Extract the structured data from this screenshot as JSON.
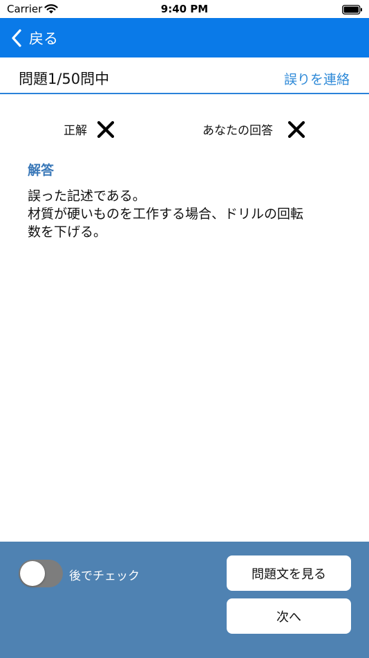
{
  "status_bar": {
    "carrier": "Carrier",
    "time": "9:40 PM"
  },
  "nav": {
    "back_label": "戻る",
    "color": "#0a7ae8"
  },
  "question": {
    "count_label": "問題1/50問中",
    "report_label": "誤りを連絡"
  },
  "result": {
    "correct_label": "正解",
    "your_answer_label": "あなたの回答",
    "correct_mark_icon": "cross-icon",
    "your_mark_icon": "cross-icon"
  },
  "answer": {
    "heading": "解答",
    "lines": [
      "誤った記述である。",
      "材質が硬いものを工作する場合、ドリルの回転",
      "数を下げる。"
    ]
  },
  "bottom": {
    "toggle_label": "後でチェック",
    "toggle_on": false,
    "view_question_label": "問題文を見る",
    "next_label": "次へ",
    "panel_color": "#4f82b2"
  }
}
